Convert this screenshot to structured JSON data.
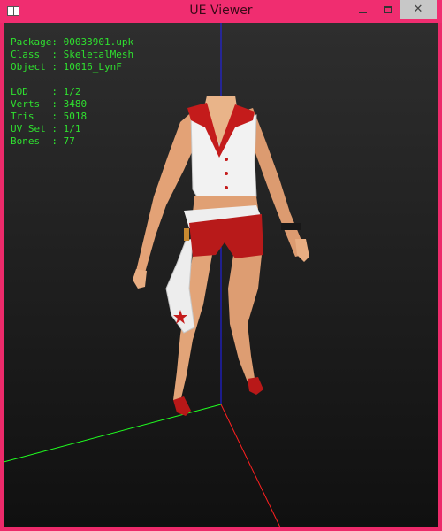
{
  "window": {
    "title": "UE Viewer"
  },
  "info": {
    "package": {
      "label": "Package:",
      "value": "00033901.upk"
    },
    "class": {
      "label": "Class  :",
      "value": "SkeletalMesh"
    },
    "object": {
      "label": "Object :",
      "value": "10016_LynF"
    },
    "lod": {
      "label": "LOD    :",
      "value": "1/2"
    },
    "verts": {
      "label": "Verts  :",
      "value": "3480"
    },
    "tris": {
      "label": "Tris   :",
      "value": "5018"
    },
    "uvset": {
      "label": "UV Set :",
      "value": "1/1"
    },
    "bones": {
      "label": "Bones  :",
      "value": "77"
    }
  },
  "colors": {
    "frame": "#ec2a6a",
    "info_text": "#2fe02f",
    "axis_x": "#ff2020",
    "axis_y": "#20ff20",
    "axis_z": "#2020ff"
  }
}
